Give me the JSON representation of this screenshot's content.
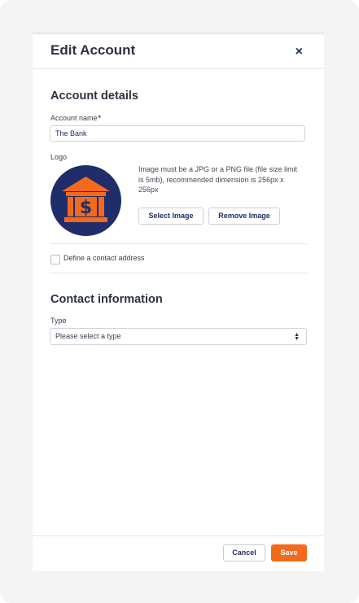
{
  "modal": {
    "title": "Edit Account",
    "close_label": "×"
  },
  "account_details": {
    "heading": "Account details",
    "name_label": "Account name",
    "required_mark": "*",
    "name_value": "The Bank",
    "logo_label": "Logo",
    "logo_icon": "bank-dollar-icon",
    "logo_colors": {
      "background": "#1f2d6b",
      "icon": "#f36a1d"
    },
    "logo_help": "Image must be a JPG or a PNG file (file size limit is 5mb), recommended dimension is 256px x 256px",
    "select_image_label": "Select Image",
    "remove_image_label": "Remove Image",
    "contact_address_label": "Define a contact address",
    "contact_address_checked": false
  },
  "contact_information": {
    "heading": "Contact information",
    "type_label": "Type",
    "type_placeholder": "Please select a type"
  },
  "footer": {
    "cancel_label": "Cancel",
    "save_label": "Save"
  },
  "colors": {
    "accent": "#f36a1d",
    "primary_text": "#1f2d6b",
    "page_background": "#f4f4f5"
  }
}
